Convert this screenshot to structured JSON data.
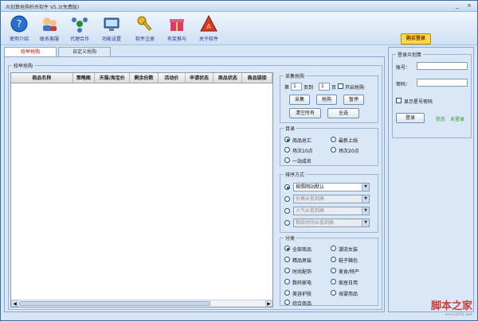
{
  "window": {
    "title": "众划算抢购秒杀软件 V5.3(免费版)",
    "minimize": "_",
    "close": "×"
  },
  "toolbar": {
    "items": [
      {
        "label": "使用介绍",
        "icon": "help-icon"
      },
      {
        "label": "联系客服",
        "icon": "support-icon"
      },
      {
        "label": "代理合作",
        "icon": "partner-icon"
      },
      {
        "label": "功能设置",
        "icon": "settings-icon"
      },
      {
        "label": "软件注册",
        "icon": "key-icon"
      },
      {
        "label": "有奖推与",
        "icon": "gift-icon"
      },
      {
        "label": "关于软件",
        "icon": "about-icon"
      }
    ],
    "login_badge": "购买登录"
  },
  "tabs": [
    {
      "label": "校举抢购"
    },
    {
      "label": "自定义抢购"
    }
  ],
  "main": {
    "group_title": "校举抢购",
    "columns": [
      "商品名称",
      "策略图",
      "天猫/淘宝价",
      "剩余份数",
      "活动价",
      "申请状态",
      "商品状态",
      "商品链接"
    ]
  },
  "collect": {
    "title": "采集抢购",
    "page_prefix": "第",
    "page_from": "1",
    "page_mid": "页到",
    "page_to": "1",
    "page_suffix": "页",
    "open_rush": "开启抢购",
    "btn_collect": "采集",
    "btn_rush": "抢购",
    "btn_pause": "暂停",
    "btn_clear": "清空所有",
    "btn_select_all": "全选"
  },
  "catalog": {
    "title": "目录",
    "options": [
      "商品总汇",
      "最新上线",
      "场次10点",
      "场次20点",
      "一站成名"
    ],
    "selected": 0
  },
  "sort": {
    "title": "排序方式",
    "selects": [
      "按照网站默认",
      "价格从低到高",
      "人气从低到高",
      "剩余时间从低到高"
    ]
  },
  "category": {
    "title": "分类",
    "options": [
      "全部商品",
      "潮流女装",
      "精品男装",
      "鞋子箱包",
      "时尚配饰",
      "美食/特产",
      "数码家电",
      "家居日用",
      "美容护肤",
      "母婴用品",
      "综合商品"
    ],
    "selected": 0
  },
  "login": {
    "title": "登录众划算",
    "account_label": "账号：",
    "password_label": "密码：",
    "remember_label": "显示星号密码",
    "btn_login": "登录",
    "status_label": "状态",
    "status_value": "未登录"
  },
  "watermark": {
    "text": "脚本之家",
    "url": "www.jb51.net"
  },
  "colors": {
    "accent": "#1a3a8a",
    "status": "#2a9a2a",
    "watermark": "#d23a3a"
  }
}
